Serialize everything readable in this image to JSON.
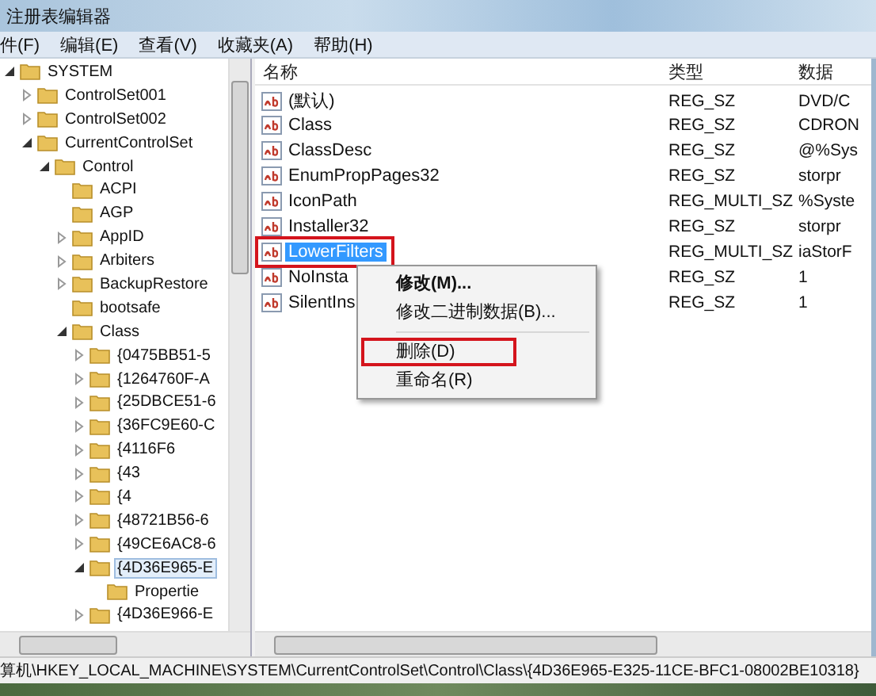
{
  "window": {
    "title": "注册表编辑器"
  },
  "menu": [
    "件(F)",
    "编辑(E)",
    "查看(V)",
    "收藏夹(A)",
    "帮助(H)"
  ],
  "tree": [
    {
      "label": "SYSTEM",
      "expanded": true,
      "selected": false,
      "children": [
        {
          "label": "ControlSet001",
          "expanded": false,
          "selected": false
        },
        {
          "label": "ControlSet002",
          "expanded": false,
          "selected": false
        },
        {
          "label": "CurrentControlSet",
          "expanded": true,
          "selected": false,
          "children": [
            {
              "label": "Control",
              "expanded": true,
              "selected": false,
              "children": [
                {
                  "label": "ACPI",
                  "selected": false
                },
                {
                  "label": "AGP",
                  "selected": false
                },
                {
                  "label": "AppID",
                  "expanded": false,
                  "selected": false
                },
                {
                  "label": "Arbiters",
                  "expanded": false,
                  "selected": false
                },
                {
                  "label": "BackupRestore",
                  "expanded": false,
                  "selected": false
                },
                {
                  "label": "bootsafe",
                  "selected": false
                },
                {
                  "label": "Class",
                  "expanded": true,
                  "selected": false,
                  "children": [
                    {
                      "label": "{0475BB51-5",
                      "expanded": false,
                      "selected": false
                    },
                    {
                      "label": "{1264760F-A",
                      "expanded": false,
                      "selected": false
                    },
                    {
                      "label": "{25DBCE51-6",
                      "expanded": false,
                      "selected": false
                    },
                    {
                      "label": "{36FC9E60-C",
                      "expanded": false,
                      "selected": false
                    },
                    {
                      "label": "{4116F6",
                      "expanded": false,
                      "selected": false
                    },
                    {
                      "label": "{43",
                      "expanded": false,
                      "selected": false
                    },
                    {
                      "label": "{4",
                      "expanded": false,
                      "selected": false
                    },
                    {
                      "label": "{48721B56-6",
                      "expanded": false,
                      "selected": false
                    },
                    {
                      "label": "{49CE6AC8-6",
                      "expanded": false,
                      "selected": false
                    },
                    {
                      "label": "{4D36E965-E",
                      "expanded": true,
                      "selected": true,
                      "children": [
                        {
                          "label": "Propertie",
                          "selected": false
                        }
                      ]
                    },
                    {
                      "label": "{4D36E966-E",
                      "expanded": false,
                      "selected": false
                    }
                  ]
                }
              ]
            }
          ]
        }
      ]
    }
  ],
  "list": {
    "columns": [
      "名称",
      "类型",
      "数据"
    ],
    "rows": [
      {
        "name": "(默认)",
        "type": "REG_SZ",
        "data": "DVD/C",
        "selected": false,
        "highlighted": false
      },
      {
        "name": "Class",
        "type": "REG_SZ",
        "data": "CDRON",
        "selected": false,
        "highlighted": false
      },
      {
        "name": "ClassDesc",
        "type": "REG_SZ",
        "data": "@%Sys",
        "selected": false,
        "highlighted": false
      },
      {
        "name": "EnumPropPages32",
        "type": "REG_SZ",
        "data": "storpr",
        "selected": false,
        "highlighted": false
      },
      {
        "name": "IconPath",
        "type": "REG_MULTI_SZ",
        "data": "%Syste",
        "selected": false,
        "highlighted": false
      },
      {
        "name": "Installer32",
        "type": "REG_SZ",
        "data": "storpr",
        "selected": false,
        "highlighted": false
      },
      {
        "name": "LowerFilters",
        "type": "REG_MULTI_SZ",
        "data": "iaStorF",
        "selected": true,
        "highlighted": true
      },
      {
        "name": "NoInsta",
        "type": "REG_SZ",
        "data": "1",
        "selected": false,
        "highlighted": false
      },
      {
        "name": "SilentIns",
        "type": "REG_SZ",
        "data": "1",
        "selected": false,
        "highlighted": false
      }
    ]
  },
  "context_menu": [
    {
      "kind": "item",
      "label": "修改(M)...",
      "bold": true,
      "highlighted": false
    },
    {
      "kind": "item",
      "label": "修改二进制数据(B)...",
      "bold": false,
      "highlighted": false
    },
    {
      "kind": "separator"
    },
    {
      "kind": "item",
      "label": "删除(D)",
      "bold": false,
      "highlighted": true
    },
    {
      "kind": "item",
      "label": "重命名(R)",
      "bold": false,
      "highlighted": false
    }
  ],
  "status_bar": "算机\\HKEY_LOCAL_MACHINE\\SYSTEM\\CurrentControlSet\\Control\\Class\\{4D36E965-E325-11CE-BFC1-08002BE10318}"
}
